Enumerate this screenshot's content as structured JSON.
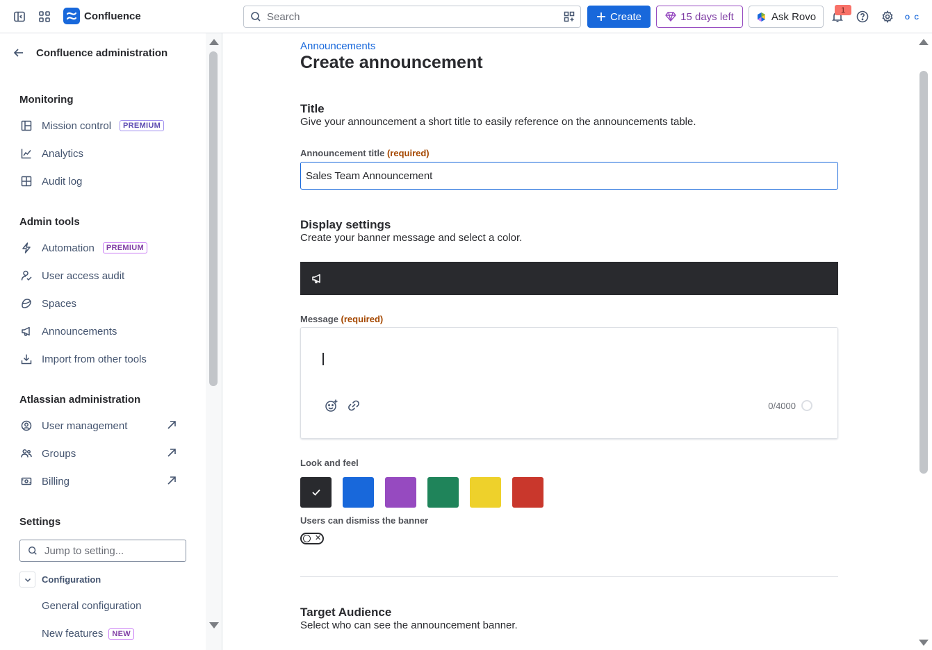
{
  "topbar": {
    "app_name": "Confluence",
    "search_placeholder": "Search",
    "create_label": "Create",
    "trial_label": "15 days left",
    "rovo_label": "Ask Rovo",
    "notification_count": "1",
    "avatar_text": "O C"
  },
  "sidebar": {
    "title": "Confluence administration",
    "sections": {
      "monitoring": "Monitoring",
      "admin_tools": "Admin tools",
      "atlassian_admin": "Atlassian administration",
      "settings": "Settings"
    },
    "items": {
      "mission_control": "Mission control",
      "analytics": "Analytics",
      "audit_log": "Audit log",
      "automation": "Automation",
      "user_access_audit": "User access audit",
      "spaces": "Spaces",
      "announcements": "Announcements",
      "import_tools": "Import from other tools",
      "user_management": "User management",
      "groups": "Groups",
      "billing": "Billing"
    },
    "premium_badge": "PREMIUM",
    "jump_placeholder": "Jump to setting...",
    "configuration": "Configuration",
    "general_configuration": "General configuration",
    "new_features": "New features",
    "new_badge": "NEW"
  },
  "main": {
    "breadcrumb": "Announcements",
    "page_title": "Create announcement",
    "title_section": {
      "heading": "Title",
      "description": "Give your announcement a short title to easily reference on the announcements table.",
      "field_label": "Announcement title",
      "required_text": "(required)",
      "field_value": "Sales Team Announcement"
    },
    "display_section": {
      "heading": "Display settings",
      "description": "Create your banner message and select a color.",
      "message_label": "Message",
      "required_text": "(required)",
      "counter": "0/4000",
      "look_label": "Look and feel",
      "swatches": [
        "#292a2e",
        "#1868db",
        "#964ac0",
        "#1f845a",
        "#eed12b",
        "#c9372c"
      ],
      "selected_swatch": 0,
      "dismiss_label": "Users can dismiss the banner",
      "dismiss_enabled": false
    },
    "audience_section": {
      "heading": "Target Audience",
      "description": "Select who can see the announcement banner."
    }
  }
}
